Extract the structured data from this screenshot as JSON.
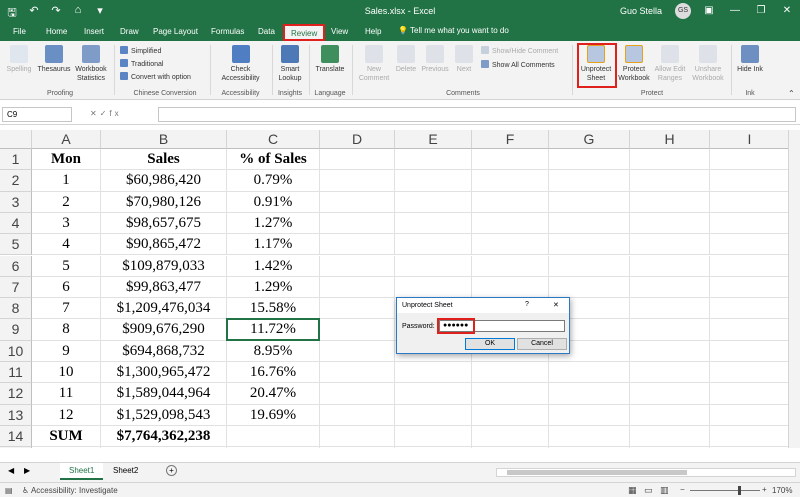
{
  "app": {
    "title": "Sales.xlsx  -  Excel",
    "user": "Guo Stella",
    "user_initials": "GS",
    "accent": "#217346",
    "highlight": "#e0201c"
  },
  "tabs": [
    "File",
    "Home",
    "Insert",
    "Draw",
    "Page Layout",
    "Formulas",
    "Data",
    "Review",
    "View",
    "Help"
  ],
  "active_tab": "Review",
  "tell_me": "Tell me what you want to do",
  "ribbon": {
    "spelling": "Spelling",
    "thesaurus": "Thesaurus",
    "workbook_statistics": "Workbook Statistics",
    "proofing": "Proofing",
    "simplified": "Simplified",
    "traditional": "Traditional",
    "convert_with_option": "Convert with option",
    "chinese_conversion": "Chinese Conversion",
    "check_accessibility": "Check Accessibility",
    "accessibility": "Accessibility",
    "smart_lookup": "Smart Lookup",
    "insights": "Insights",
    "translate": "Translate",
    "language": "Language",
    "new_comment": "New Comment",
    "delete": "Delete",
    "previous": "Previous",
    "next": "Next",
    "show_hide_comment": "Show/Hide Comment",
    "show_all_comments": "Show All Comments",
    "comments": "Comments",
    "unprotect_sheet": "Unprotect Sheet",
    "protect_workbook": "Protect Workbook",
    "allow_edit_ranges": "Allow Edit Ranges",
    "unshare_workbook": "Unshare Workbook",
    "protect": "Protect",
    "hide_ink": "Hide Ink",
    "ink": "Ink"
  },
  "formula_bar": {
    "name_box": "C9",
    "fx": "fx",
    "value": ""
  },
  "columns": [
    "A",
    "B",
    "C",
    "D",
    "E",
    "F",
    "G",
    "H",
    "I"
  ],
  "rows": [
    [
      "Mon",
      "Sales",
      "% of Sales"
    ],
    [
      "1",
      "$60,986,420",
      "0.79%"
    ],
    [
      "2",
      "$70,980,126",
      "0.91%"
    ],
    [
      "3",
      "$98,657,675",
      "1.27%"
    ],
    [
      "4",
      "$90,865,472",
      "1.17%"
    ],
    [
      "5",
      "$109,879,033",
      "1.42%"
    ],
    [
      "6",
      "$99,863,477",
      "1.29%"
    ],
    [
      "7",
      "$1,209,476,034",
      "15.58%"
    ],
    [
      "8",
      "$909,676,290",
      "11.72%"
    ],
    [
      "9",
      "$694,868,732",
      "8.95%"
    ],
    [
      "10",
      "$1,300,965,472",
      "16.76%"
    ],
    [
      "11",
      "$1,589,044,964",
      "20.47%"
    ],
    [
      "12",
      "$1,529,098,543",
      "19.69%"
    ],
    [
      "SUM",
      "$7,764,362,238",
      ""
    ],
    [
      "",
      "",
      ""
    ]
  ],
  "sheets": [
    "Sheet1",
    "Sheet2"
  ],
  "active_sheet": "Sheet1",
  "status": {
    "accessibility": "Accessibility: Investigate",
    "zoom": "170%"
  },
  "dialog": {
    "title": "Unprotect Sheet",
    "help": "?",
    "close": "✕",
    "password_label": "Password:",
    "password_value": "●●●●●●",
    "ok": "OK",
    "cancel": "Cancel"
  }
}
